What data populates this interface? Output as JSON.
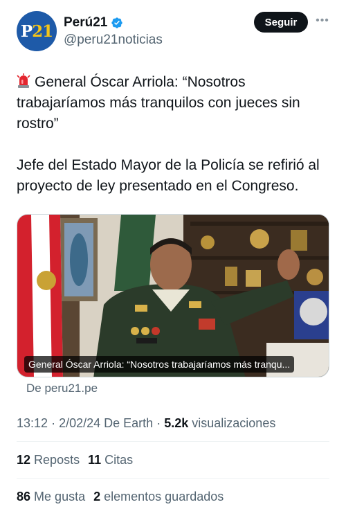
{
  "account": {
    "display_name": "Perú21",
    "handle": "@peru21noticias",
    "avatar_letter": "P",
    "avatar_number": "21",
    "verified": true,
    "follow_label": "Seguir",
    "more_icon": "more-horizontal-icon"
  },
  "tweet": {
    "emoji": "rotating-light-icon",
    "line1": "General Óscar Arriola: “Nosotros trabajaríamos más tranquilos con jueces sin rostro”",
    "line2": "Jefe del Estado Mayor de la Policía se refirió al proyecto de ley presentado en el Congreso."
  },
  "card": {
    "caption": "General Óscar Arriola: “Nosotros trabajaríamos más tranqu...",
    "source": "De peru21.pe",
    "name_tag": "ARRIOLA"
  },
  "meta": {
    "time": "13:12",
    "date": "2/02/24",
    "client": "De Earth",
    "views_count": "5.2k",
    "views_label": "visualizaciones"
  },
  "stats": {
    "reposts_count": "12",
    "reposts_label": "Reposts",
    "quotes_count": "11",
    "quotes_label": "Citas",
    "likes_count": "86",
    "likes_label": "Me gusta",
    "bookmarks_count": "2",
    "bookmarks_label": "elementos guardados"
  },
  "colors": {
    "accent": "#1d9bf0",
    "muted": "#536471",
    "brand": "#1e5aa8"
  }
}
